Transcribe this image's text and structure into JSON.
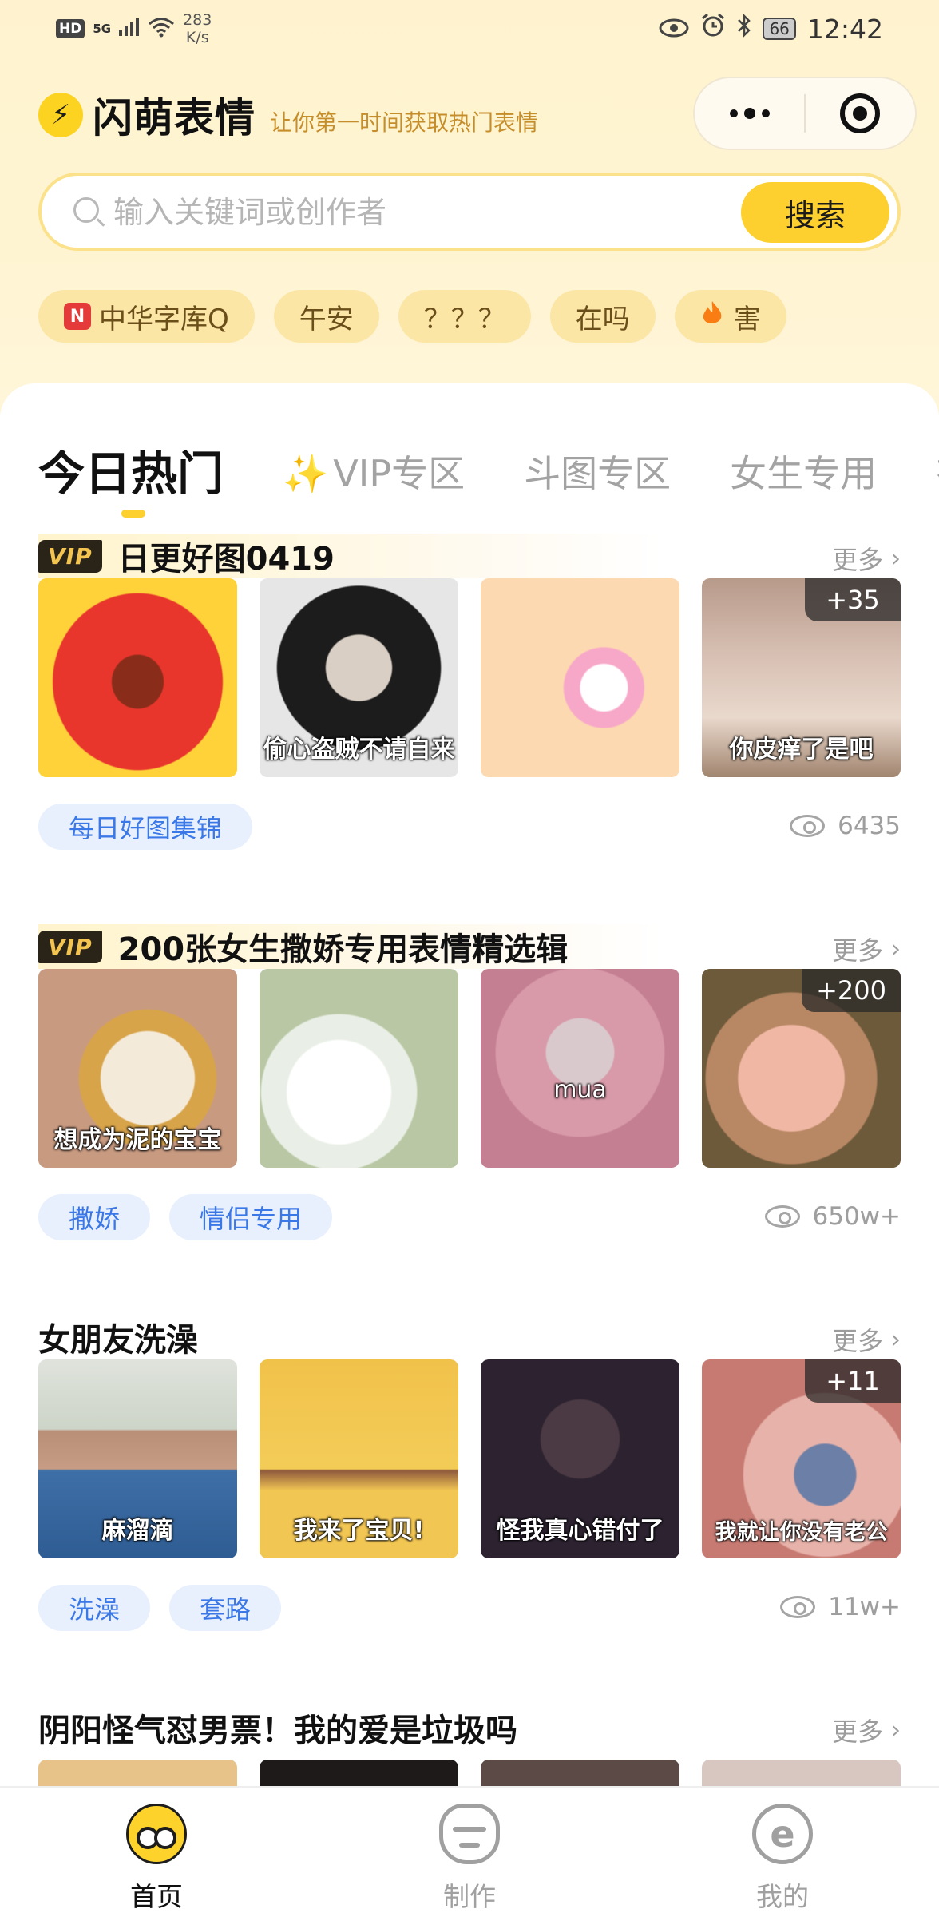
{
  "status_bar": {
    "hd": "HD",
    "signal": "5G",
    "speed_value": "283",
    "speed_unit": "K/s",
    "battery": "66",
    "time": "12:42"
  },
  "header": {
    "app_name": "闪萌表情",
    "slogan": "让你第一时间获取热门表情"
  },
  "search": {
    "placeholder": "输入关键词或创作者",
    "button": "搜索"
  },
  "hot_tags": [
    {
      "label": "中华字库Q",
      "badge": "N"
    },
    {
      "label": "午安"
    },
    {
      "label": "？？？"
    },
    {
      "label": "在吗"
    },
    {
      "label": "害",
      "icon": "fire-icon"
    }
  ],
  "tabs": [
    {
      "label": "今日热门",
      "active": true
    },
    {
      "label": "VIP专区"
    },
    {
      "label": "斗图专区"
    },
    {
      "label": "女生专用"
    },
    {
      "label": "有"
    }
  ],
  "more_label": "更多",
  "vip_badge": "VIP",
  "sections": [
    {
      "title": "日更好图0419",
      "vip": true,
      "thumbs": [
        {
          "caption": ""
        },
        {
          "caption": "偷心盗贼不请自来"
        },
        {
          "caption": ""
        },
        {
          "caption": "你皮痒了是吧",
          "extra": "+35"
        }
      ],
      "tags": [
        "每日好图集锦"
      ],
      "views": "6435"
    },
    {
      "title": "200张女生撒娇专用表情精选辑",
      "vip": true,
      "thumbs": [
        {
          "caption": "想成为泥的宝宝"
        },
        {
          "caption": ""
        },
        {
          "caption": "mua"
        },
        {
          "caption": "",
          "extra": "+200"
        }
      ],
      "tags": [
        "撒娇",
        "情侣专用"
      ],
      "views": "650w+"
    },
    {
      "title": "女朋友洗澡",
      "vip": false,
      "thumbs": [
        {
          "caption": "麻溜滴"
        },
        {
          "caption": "我来了宝贝!"
        },
        {
          "caption": "怪我真心错付了"
        },
        {
          "caption": "我就让你没有老公",
          "extra": "+11"
        }
      ],
      "tags": [
        "洗澡",
        "套路"
      ],
      "views": "11w+"
    },
    {
      "title": "阴阳怪气怼男票！我的爱是垃圾吗",
      "vip": false
    }
  ],
  "bottom_nav": [
    {
      "label": "首页",
      "icon": "home-face-icon",
      "active": true
    },
    {
      "label": "制作",
      "icon": "make-face-icon"
    },
    {
      "label": "我的",
      "icon": "me-face-icon"
    }
  ],
  "colors": {
    "brand_yellow": "#fdcf2f",
    "header_bg": "#fff3cf",
    "tag_blue": "#3b78e7",
    "tag_bg": "#e8f0fe",
    "slogan": "#c58e2b"
  }
}
